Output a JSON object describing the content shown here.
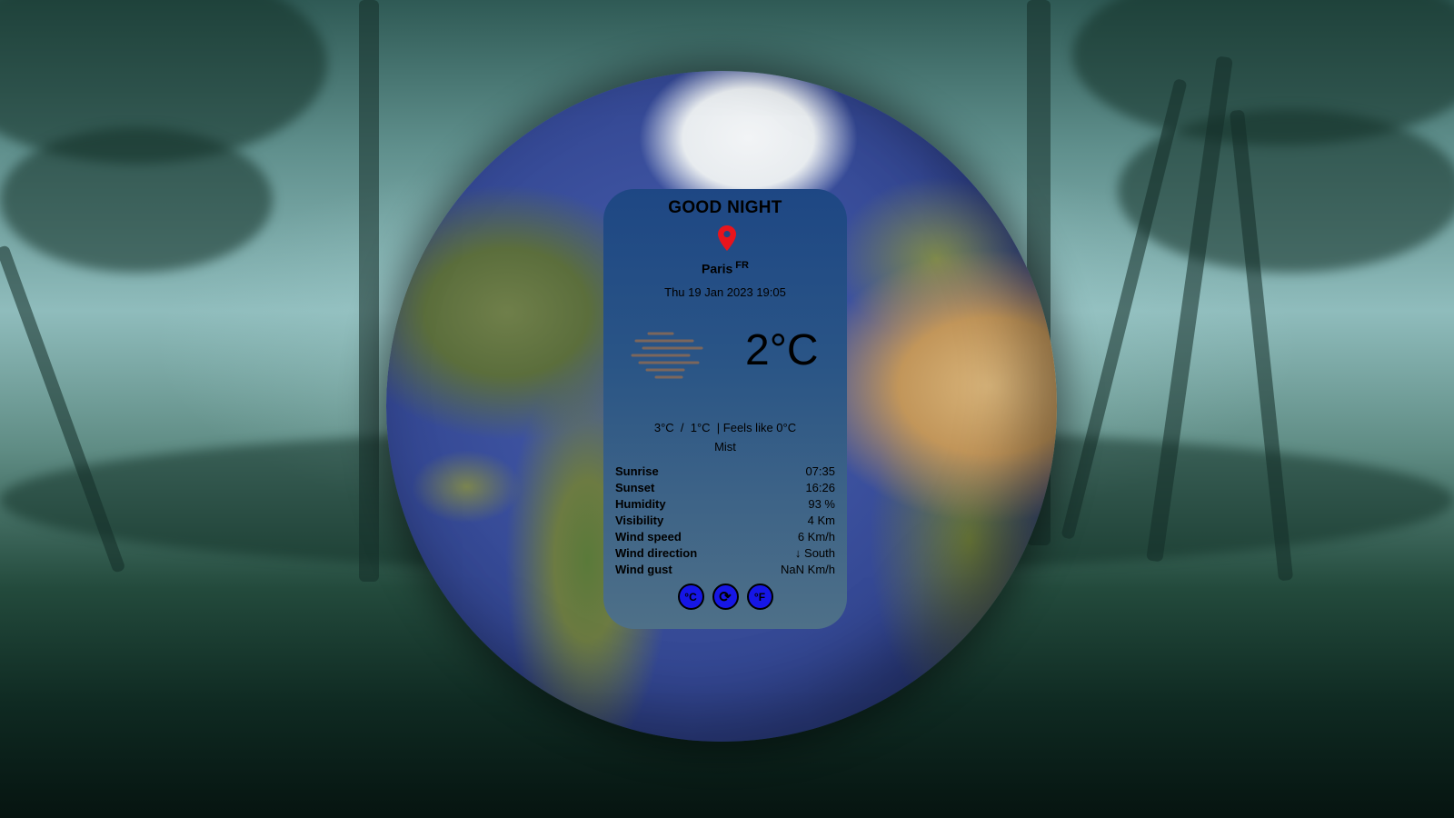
{
  "greeting": "GOOD NIGHT",
  "location": {
    "city": "Paris",
    "country": "FR"
  },
  "datetime": "Thu 19 Jan 2023 19:05",
  "weather": {
    "icon": "mist-icon",
    "temperature": "2°C",
    "minmax": "3°C  /  1°C  | Feels like 0°C",
    "condition": "Mist"
  },
  "details": [
    {
      "label": "Sunrise",
      "value": "07:35"
    },
    {
      "label": "Sunset",
      "value": "16:26"
    },
    {
      "label": "Humidity",
      "value": "93 %"
    },
    {
      "label": "Visibility",
      "value": "4 Km"
    },
    {
      "label": "Wind speed",
      "value": "6 Km/h"
    },
    {
      "label": "Wind direction",
      "value": "↓ South"
    },
    {
      "label": "Wind gust",
      "value": "NaN Km/h"
    }
  ],
  "buttons": {
    "celsius": "°C",
    "refresh": "⟳",
    "fahrenheit": "°F"
  },
  "colors": {
    "button": "#1616e6",
    "pin": "#e8141c"
  }
}
